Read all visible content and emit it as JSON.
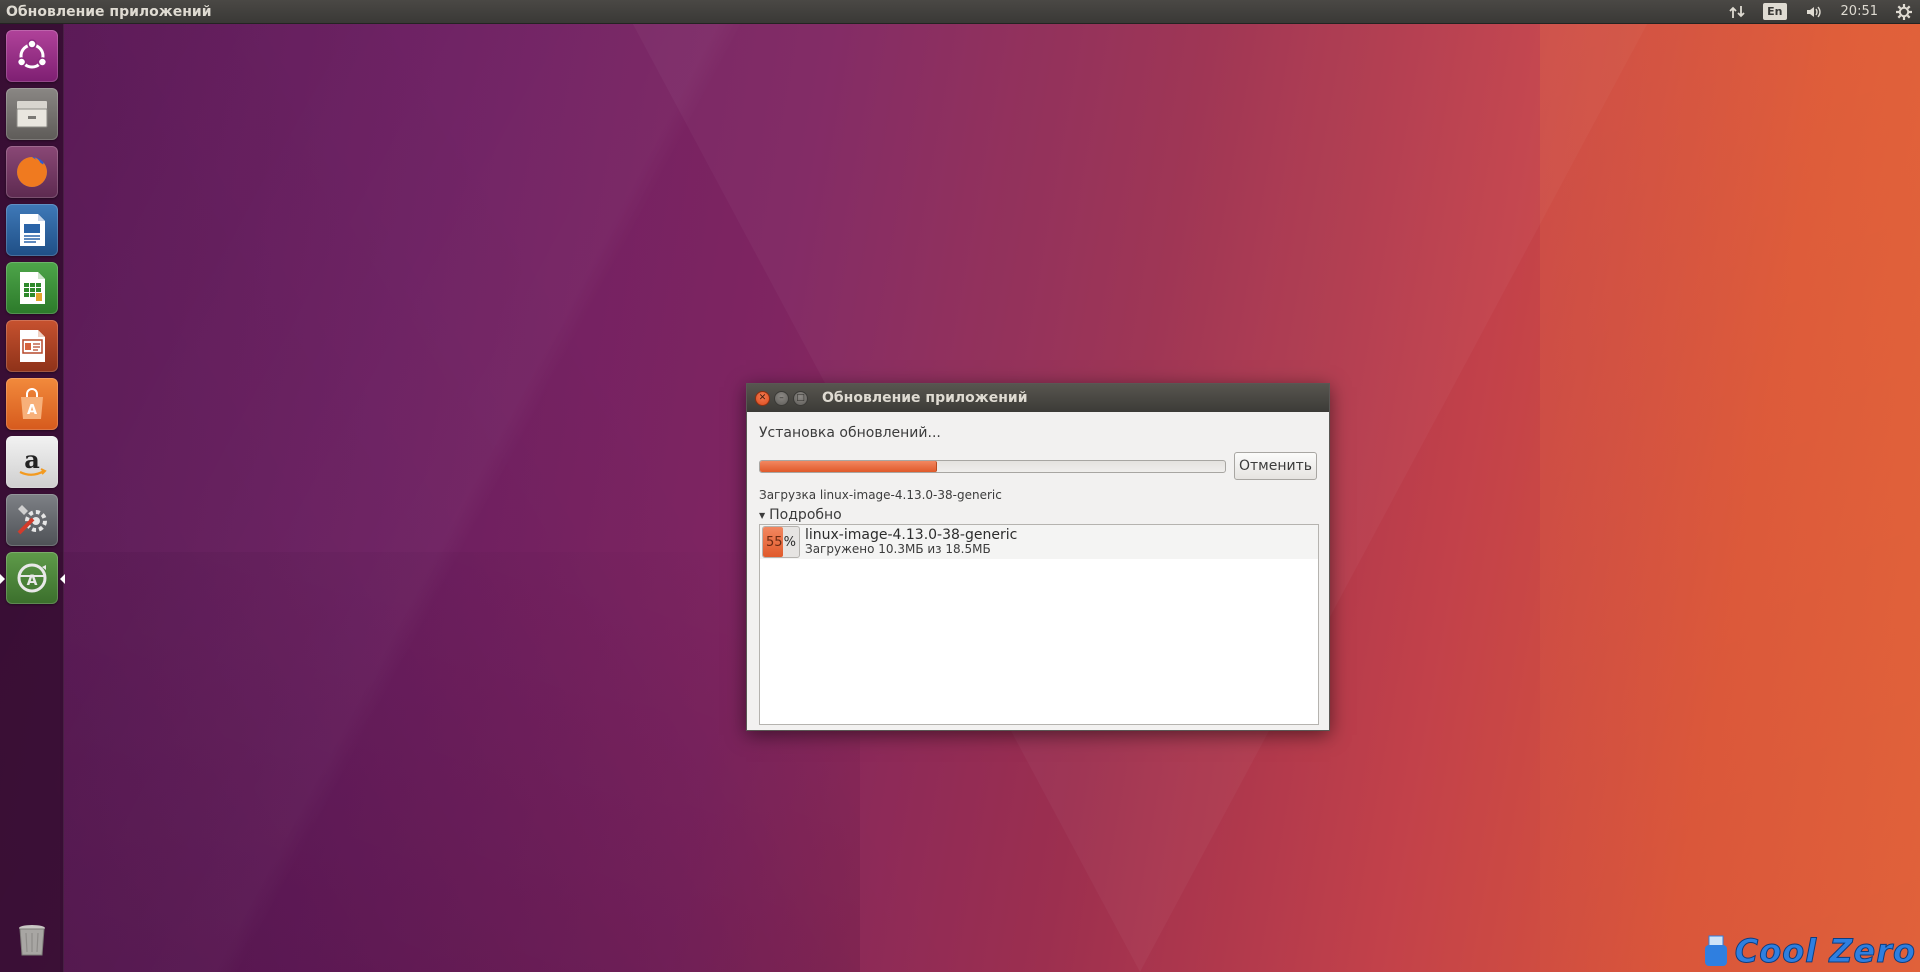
{
  "top_panel": {
    "title": "Обновление приложений",
    "language": "En",
    "clock": "20:51",
    "icons": [
      "network-arrows-icon",
      "language-indicator",
      "volume-icon",
      "gear-icon"
    ]
  },
  "launcher": {
    "items": [
      {
        "name": "ubuntu-dash",
        "icon": "ubuntu-logo-icon"
      },
      {
        "name": "files",
        "icon": "file-cabinet-icon"
      },
      {
        "name": "firefox",
        "icon": "firefox-icon"
      },
      {
        "name": "libreoffice-writer",
        "icon": "writer-icon"
      },
      {
        "name": "libreoffice-calc",
        "icon": "calc-icon"
      },
      {
        "name": "libreoffice-impress",
        "icon": "impress-icon"
      },
      {
        "name": "ubuntu-software",
        "icon": "software-bag-icon"
      },
      {
        "name": "amazon",
        "icon": "amazon-icon"
      },
      {
        "name": "system-settings",
        "icon": "settings-tools-icon"
      },
      {
        "name": "software-updater",
        "icon": "software-updater-icon"
      },
      {
        "name": "trash",
        "icon": "trash-icon"
      }
    ],
    "accent_colors": {
      "dash": "#8b2a7e",
      "software": "#e8692c",
      "updater": "#4d8a3a"
    }
  },
  "dialog": {
    "title": "Обновление приложений",
    "status": "Установка обновлений...",
    "progress": 0.38,
    "cancel_label": "Отменить",
    "download_text": "Загрузка linux-image-4.13.0-38-generic",
    "details_label": "Подробно",
    "items": [
      {
        "percent": 55,
        "percent_label": "55",
        "percent_sign": "%",
        "package": "linux-image-4.13.0-38-generic",
        "detail": "Загружено 10.3МБ из 18.5МБ"
      }
    ]
  },
  "watermark": {
    "text": "Cool Zero"
  },
  "colors": {
    "accent": "#e05a2b",
    "panel": "#3c3b37"
  }
}
